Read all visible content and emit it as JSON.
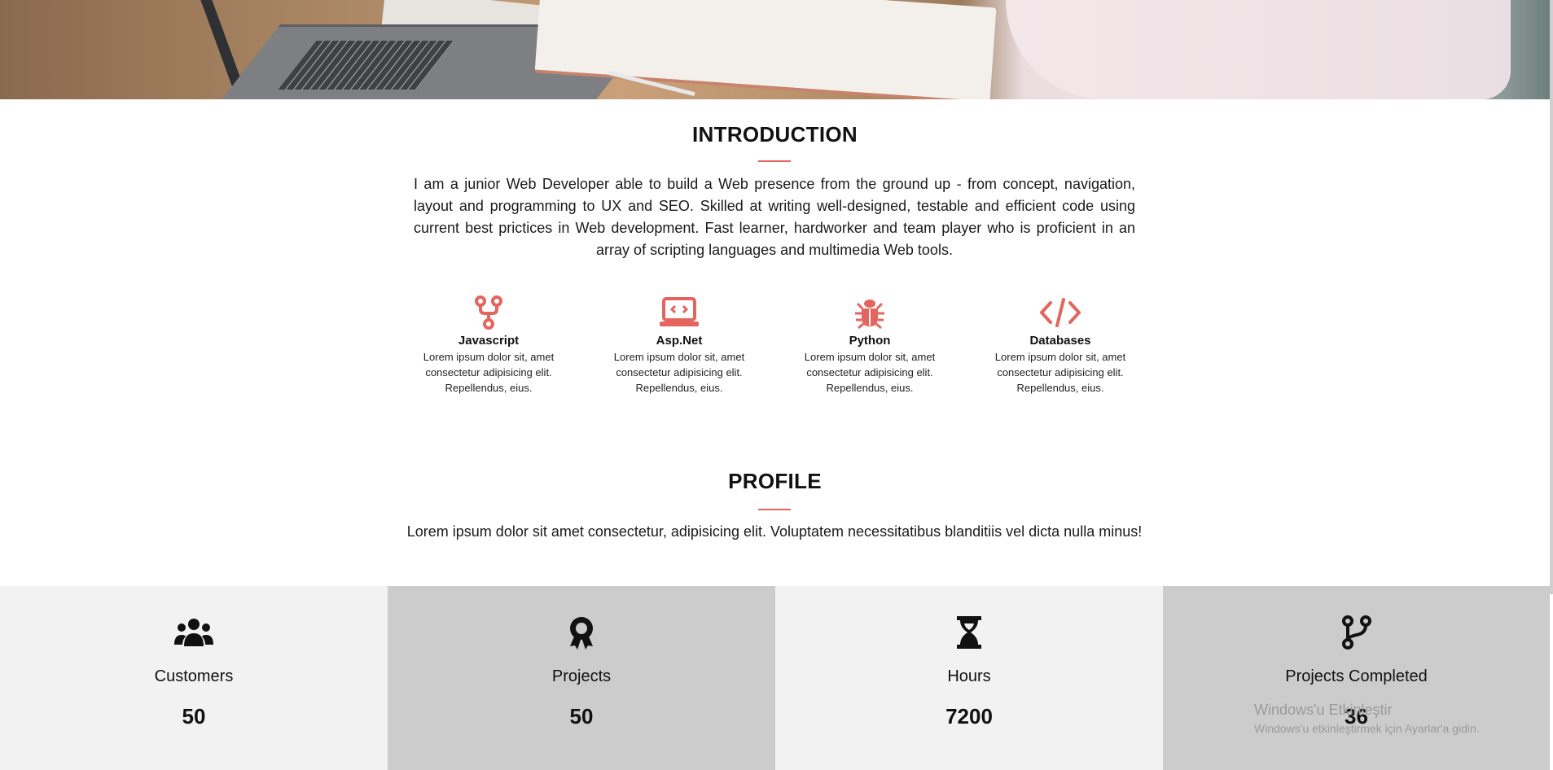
{
  "hero": {
    "image": "laptop-desk-photo"
  },
  "introduction": {
    "title": "INTRODUCTION",
    "text": "I am a junior Web Developer able to build a Web presence from the ground up - from concept, navigation, layout and programming to UX and SEO. Skilled at writing well-designed, testable and efficient code using current best prictices in Web development. Fast learner, hardworker and team player who is proficient in an array of scripting languages and multimedia Web tools."
  },
  "skills": [
    {
      "icon": "code-fork-icon",
      "name": "Javascript",
      "desc": "Lorem ipsum dolor sit, amet consectetur adipisicing elit. Repellendus, eius."
    },
    {
      "icon": "laptop-code-icon",
      "name": "Asp.Net",
      "desc": "Lorem ipsum dolor sit, amet consectetur adipisicing elit. Repellendus, eius."
    },
    {
      "icon": "bug-icon",
      "name": "Python",
      "desc": "Lorem ipsum dolor sit, amet consectetur adipisicing elit. Repellendus, eius."
    },
    {
      "icon": "code-icon",
      "name": "Databases",
      "desc": "Lorem ipsum dolor sit, amet consectetur adipisicing elit. Repellendus, eius."
    }
  ],
  "profile": {
    "title": "PROFILE",
    "text": "Lorem ipsum dolor sit amet consectetur, adipisicing elit. Voluptatem necessitatibus blanditiis vel dicta nulla minus!"
  },
  "stats": [
    {
      "icon": "users-icon",
      "label": "Customers",
      "value": "50"
    },
    {
      "icon": "award-icon",
      "label": "Projects",
      "value": "50"
    },
    {
      "icon": "hourglass-icon",
      "label": "Hours",
      "value": "7200"
    },
    {
      "icon": "code-branch-icon",
      "label": "Projects Completed",
      "value": "36"
    }
  ],
  "watermark": {
    "line1": "Windows'u Etkinleştir",
    "line2": "Windows'u etkinleştirmek için Ayarlar'a gidin."
  },
  "colors": {
    "accent": "#e4655f",
    "stat_light": "#f2f2f2",
    "stat_dark": "#cccccc"
  }
}
